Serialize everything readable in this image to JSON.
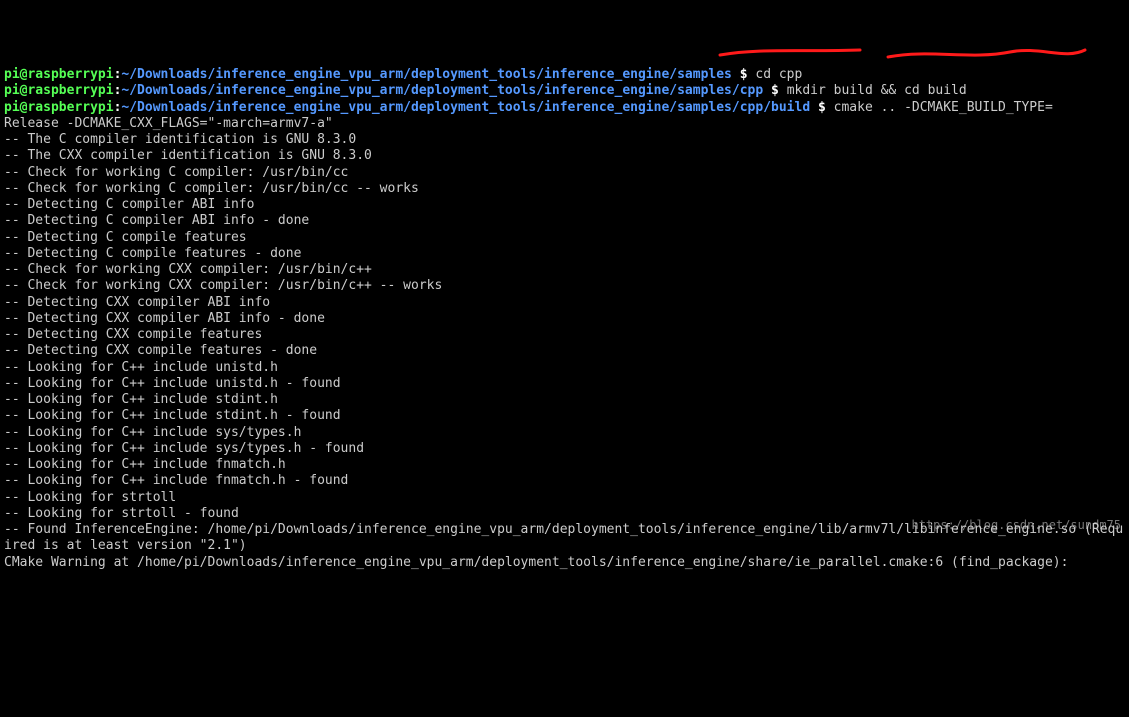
{
  "prompts": [
    {
      "user": "pi@raspberrypi",
      "colon": ":",
      "path": "~/Downloads/inference_engine_vpu_arm/deployment_tools/inference_engine/samples",
      "dollar": " $ ",
      "command": "cd cpp"
    },
    {
      "user": "pi@raspberrypi",
      "colon": ":",
      "path": "~/Downloads/inference_engine_vpu_arm/deployment_tools/inference_engine/samples/cpp",
      "dollar": " $ ",
      "command": "mkdir build && cd build"
    },
    {
      "user": "pi@raspberrypi",
      "colon": ":",
      "path": "~/Downloads/inference_engine_vpu_arm/deployment_tools/inference_engine/samples/cpp/build",
      "dollar": " $ ",
      "command": "cmake .. -DCMAKE_BUILD_TYPE="
    }
  ],
  "wrapCommand": "Release -DCMAKE_CXX_FLAGS=\"-march=armv7-a\"",
  "output": [
    "-- The C compiler identification is GNU 8.3.0",
    "-- The CXX compiler identification is GNU 8.3.0",
    "-- Check for working C compiler: /usr/bin/cc",
    "-- Check for working C compiler: /usr/bin/cc -- works",
    "-- Detecting C compiler ABI info",
    "-- Detecting C compiler ABI info - done",
    "-- Detecting C compile features",
    "-- Detecting C compile features - done",
    "-- Check for working CXX compiler: /usr/bin/c++",
    "-- Check for working CXX compiler: /usr/bin/c++ -- works",
    "-- Detecting CXX compiler ABI info",
    "-- Detecting CXX compiler ABI info - done",
    "-- Detecting CXX compile features",
    "-- Detecting CXX compile features - done",
    "-- Looking for C++ include unistd.h",
    "-- Looking for C++ include unistd.h - found",
    "-- Looking for C++ include stdint.h",
    "-- Looking for C++ include stdint.h - found",
    "-- Looking for C++ include sys/types.h",
    "-- Looking for C++ include sys/types.h - found",
    "-- Looking for C++ include fnmatch.h",
    "-- Looking for C++ include fnmatch.h - found",
    "-- Looking for strtoll",
    "-- Looking for strtoll - found",
    "-- Found InferenceEngine: /home/pi/Downloads/inference_engine_vpu_arm/deployment_tools/inference_engine/lib/armv7l/libinference_engine.so (Required is at least version \"2.1\")",
    "CMake Warning at /home/pi/Downloads/inference_engine_vpu_arm/deployment_tools/inference_engine/share/ie_parallel.cmake:6 (find_package):"
  ],
  "watermark": "https://blog.csdn.net/sundm75"
}
